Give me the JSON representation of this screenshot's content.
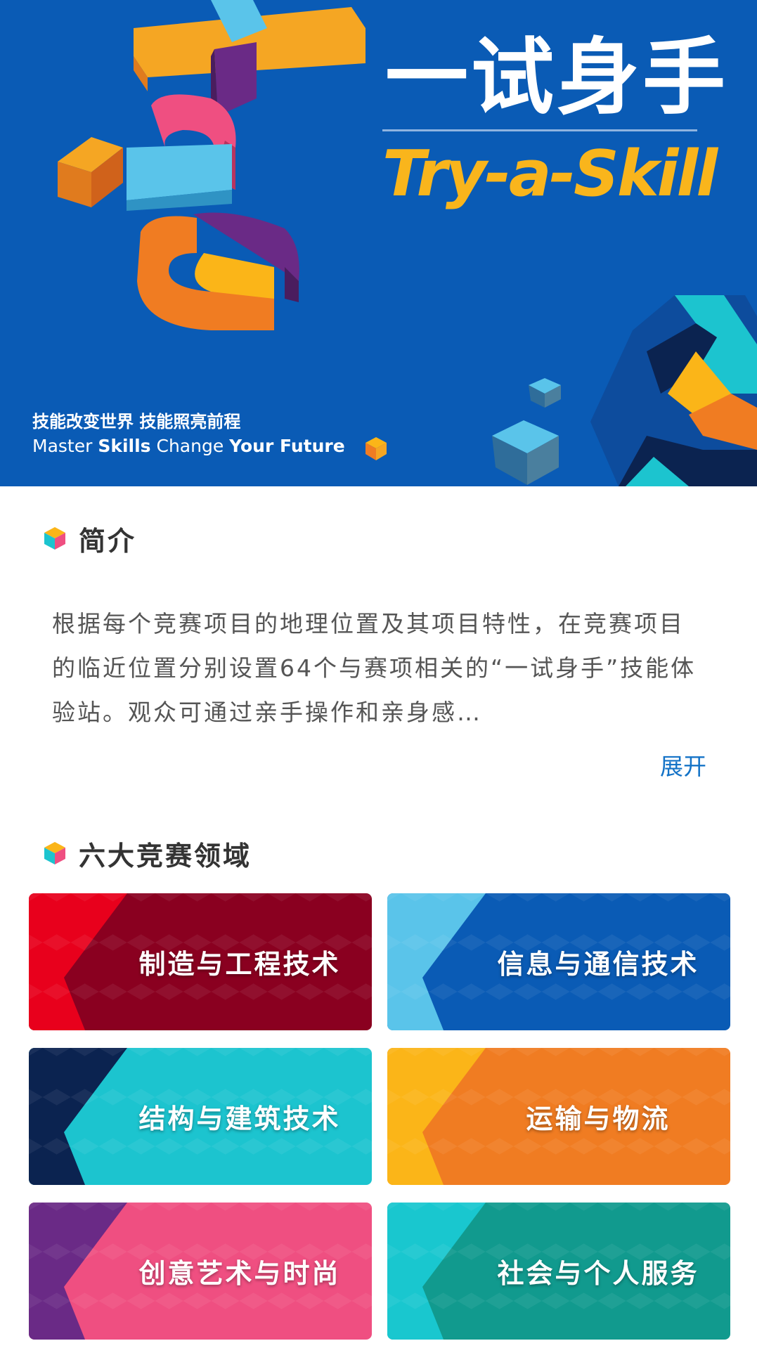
{
  "hero": {
    "title_cn": "一试身手",
    "title_en": "Try-a-Skill",
    "slogan_cn": "技能改变世界  技能照亮前程",
    "slogan_en_parts": [
      "Master ",
      "Skills",
      " Change ",
      "Your Future"
    ],
    "colors": {
      "background": "#0a5bb5",
      "accent": "#f9b51c"
    }
  },
  "intro": {
    "title": "简介",
    "text": "根据每个竞赛项目的地理位置及其项目特性，在竞赛项目的临近位置分别设置64个与赛项相关的“一试身手”技能体验站。观众可通过亲手操作和亲身感…",
    "expand_label": "展开"
  },
  "fields": {
    "title": "六大竞赛领域",
    "items": [
      {
        "label": "制造与工程技术",
        "left_color": "#e8001c",
        "main_color": "#8a0020"
      },
      {
        "label": "信息与通信技术",
        "left_color": "#5ac4ea",
        "main_color": "#0a5bb5"
      },
      {
        "label": "结构与建筑技术",
        "left_color": "#0b2350",
        "main_color": "#1cc4cf"
      },
      {
        "label": "运输与物流",
        "left_color": "#fbb518",
        "main_color": "#f07c22"
      },
      {
        "label": "创意艺术与时尚",
        "left_color": "#6a2a86",
        "main_color": "#ef4f81"
      },
      {
        "label": "社会与个人服务",
        "left_color": "#19c7cf",
        "main_color": "#119a8e"
      }
    ]
  }
}
